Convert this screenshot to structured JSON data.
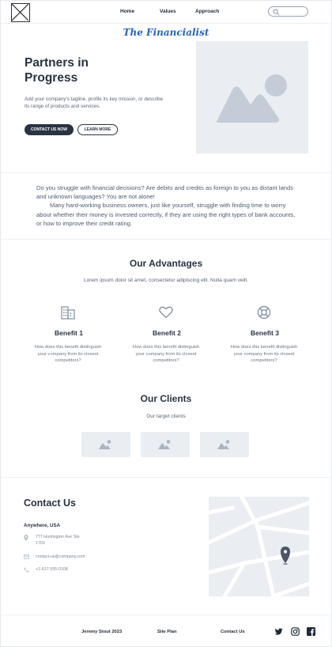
{
  "header": {
    "nav": [
      {
        "label": "Home"
      },
      {
        "label": "Values"
      },
      {
        "label": "Approach"
      }
    ],
    "brand": "The Financialist"
  },
  "hero": {
    "title": "Partners in Progress",
    "tagline": "Add your company's tagline, profile its key mission, or describe its range of products and services.",
    "primary_button": "CONTACT US NOW",
    "secondary_button": "LEARN MORE"
  },
  "intro": {
    "paragraph1": "Do you struggle with financial decisions?  Are debits and credits as foreign to you as distant lands and unknown languages?  You are not alone!",
    "paragraph2": "Many hard-working business owners, just like yourself, struggle with finding time to worry about whether their money is invested correctly, if they are using the right types of bank accounts, or how to improve their credit rating."
  },
  "advantages": {
    "title": "Our Advantages",
    "subtitle": "Lorem ipsum dolor sit amet, consectetur adipiscing elit. Nulla quam velit.",
    "benefits": [
      {
        "title": "Benefit 1",
        "text": "How does this benefit distinguish your company from its closest competitors?",
        "icon": "building-icon"
      },
      {
        "title": "Benefit 2",
        "text": "How does this benefit distinguish your company from its closest competitors?",
        "icon": "heart-icon"
      },
      {
        "title": "Benefit 3",
        "text": "How does this benefit distinguish your company from its closest competitors?",
        "icon": "lifebuoy-icon"
      }
    ]
  },
  "clients": {
    "title": "Our Clients",
    "subtitle": "Our target clients"
  },
  "contact": {
    "title": "Contact Us",
    "city": "Anywhere, USA",
    "address": "777 Huntington Ave Ste 1703",
    "email": "contact-us@company.com",
    "phone": "+1-617-555-0108"
  },
  "footer": {
    "author": "Jeremy Stout 2023",
    "site_plan": "Site Plan",
    "contact": "Contact Us"
  },
  "colors": {
    "brand": "#2563c9",
    "text_dark": "#2a3342",
    "placeholder": "#eaedf2",
    "icon": "#8a96a8"
  }
}
